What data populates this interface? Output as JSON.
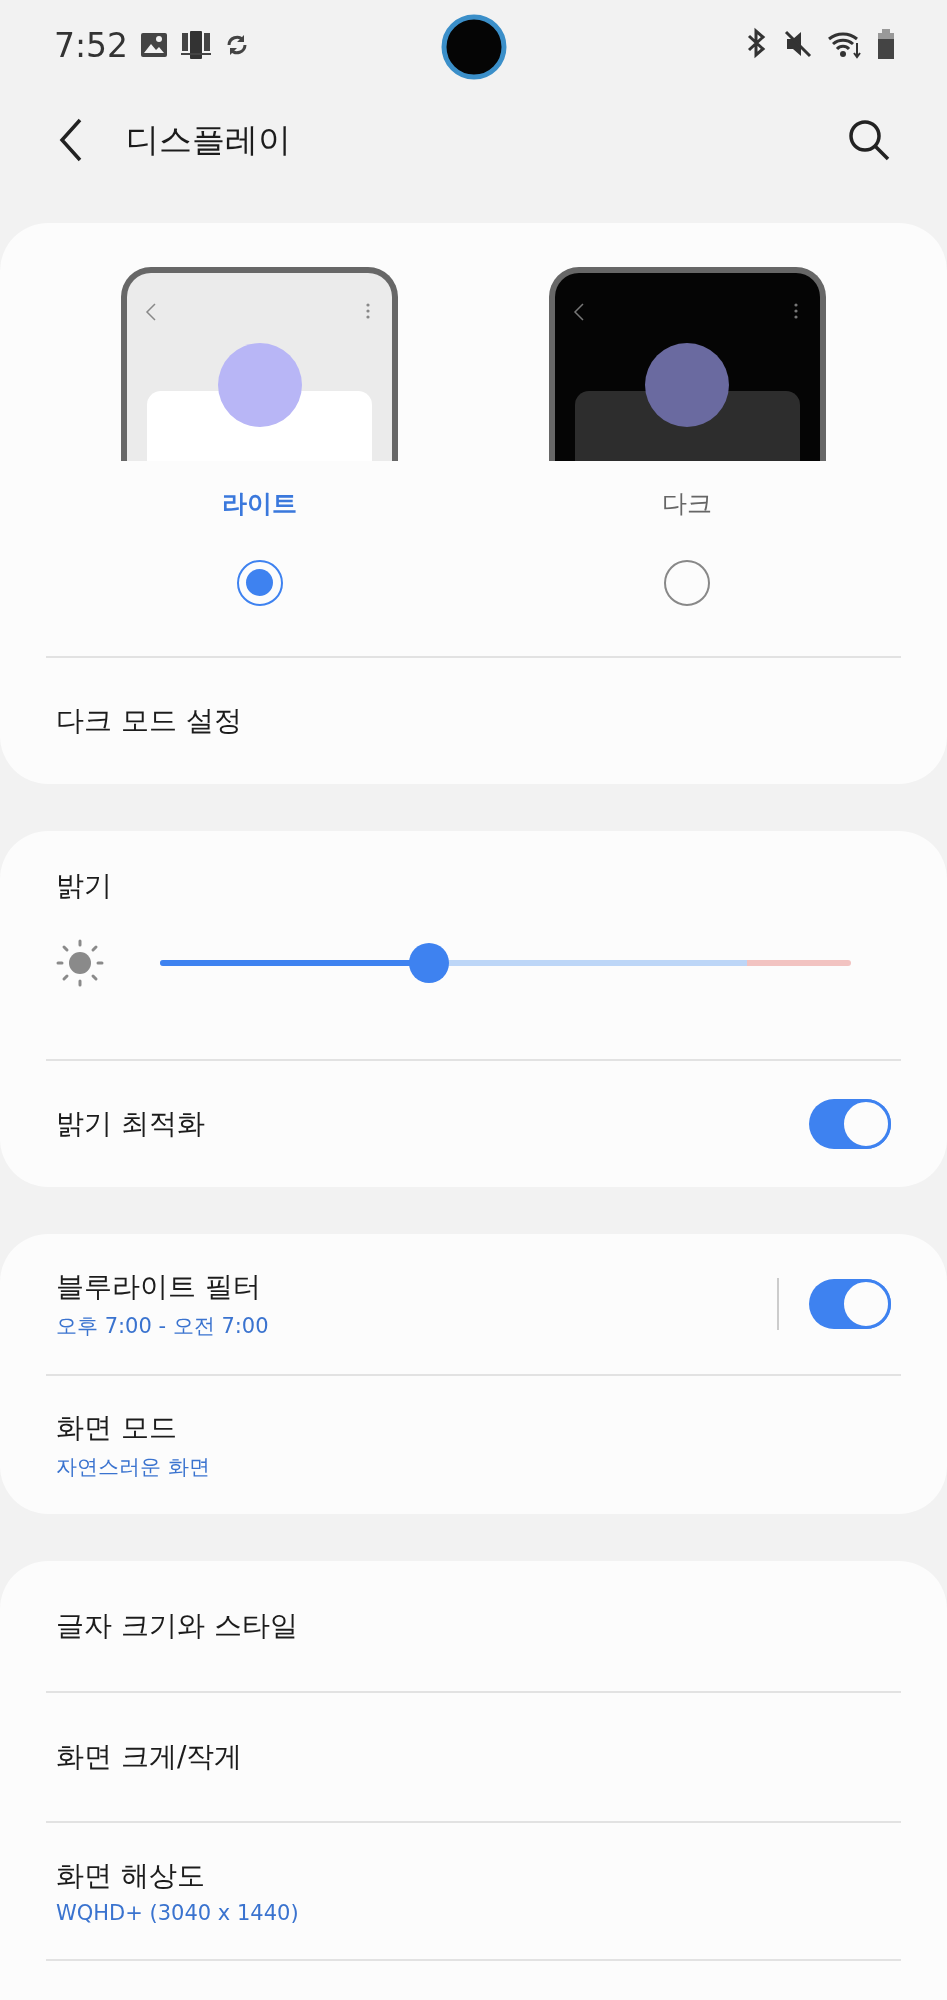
{
  "status_bar": {
    "time": "7:52"
  },
  "header": {
    "title": "디스플레이"
  },
  "theme": {
    "options": [
      {
        "label": "라이트",
        "kind": "light",
        "selected": true
      },
      {
        "label": "다크",
        "kind": "dark",
        "selected": false
      }
    ],
    "dark_mode_settings": "다크 모드 설정"
  },
  "brightness": {
    "title": "밝기",
    "level": 0.39,
    "adaptive": {
      "label": "밝기 최적화",
      "on": true
    }
  },
  "filters": [
    {
      "label": "블루라이트 필터",
      "subtitle": "오후 7:00 - 오전 7:00",
      "on": true
    },
    {
      "label": "화면 모드",
      "subtitle": "자연스러운 화면"
    }
  ],
  "more": [
    {
      "label": "글자 크기와 스타일"
    },
    {
      "label": "화면 크게/작게"
    },
    {
      "label": "화면 해상도",
      "subtitle": "WQHD+ (3040 x 1440)"
    }
  ]
}
